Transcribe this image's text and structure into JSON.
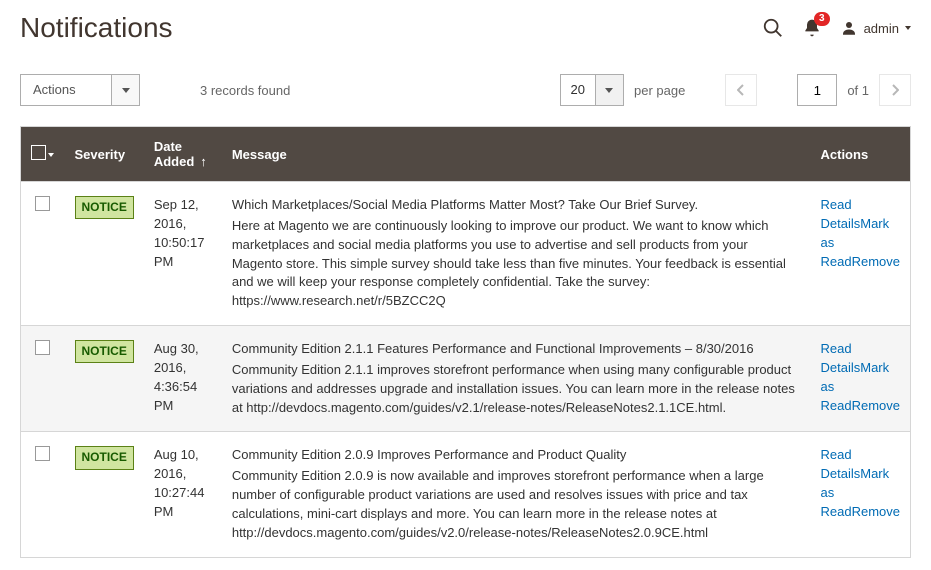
{
  "header": {
    "title": "Notifications",
    "notification_count": "3",
    "admin_label": "admin"
  },
  "toolbar": {
    "actions_label": "Actions",
    "records_found": "3 records found",
    "page_size": "20",
    "per_page_label": "per page",
    "current_page": "1",
    "of_label": "of 1"
  },
  "columns": {
    "severity": "Severity",
    "date_added": "Date Added",
    "message": "Message",
    "actions": "Actions"
  },
  "severity_label": "NOTICE",
  "action_links": {
    "read_details": "Read Details",
    "mark_as_read": "Mark as Read",
    "remove": "Remove"
  },
  "rows": [
    {
      "date": "Sep 12, 2016, 10:50:17 PM",
      "title": "Which Marketplaces/Social Media Platforms Matter Most? Take Our Brief Survey.",
      "body": "Here at Magento we are continuously looking to improve our product. We want to know which marketplaces and social media platforms you use to advertise and sell products from your Magento store. This simple survey should take less than five minutes. Your feedback is essential and we will keep your response completely confidential. Take the survey: https://www.research.net/r/5BZCC2Q"
    },
    {
      "date": "Aug 30, 2016, 4:36:54 PM",
      "title": "Community Edition 2.1.1 Features Performance and Functional Improvements – 8/30/2016",
      "body": "Community Edition 2.1.1 improves storefront performance when using many configurable product variations and addresses upgrade and installation issues. You can learn more in the release notes at http://devdocs.magento.com/guides/v2.1/release-notes/ReleaseNotes2.1.1CE.html."
    },
    {
      "date": "Aug 10, 2016, 10:27:44 PM",
      "title": "Community Edition 2.0.9 Improves Performance and Product Quality",
      "body": "Community Edition 2.0.9 is now available and improves storefront performance when a large number of configurable product variations are used and resolves issues with price and tax calculations, mini-cart displays and more. You can learn more in the release notes at http://devdocs.magento.com/guides/v2.0/release-notes/ReleaseNotes2.0.9CE.html"
    }
  ]
}
